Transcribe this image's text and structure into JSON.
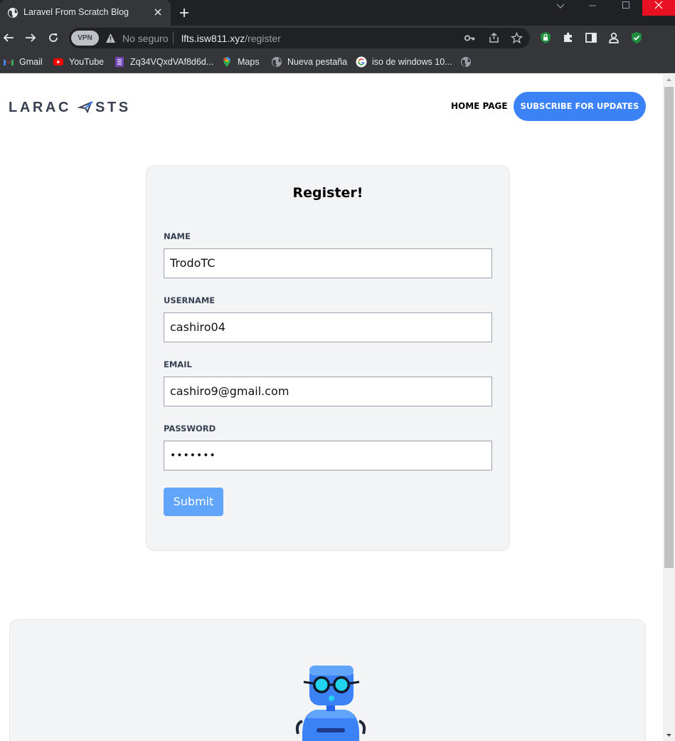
{
  "browser": {
    "tab_title": "Laravel From Scratch Blog",
    "vpn_label": "VPN",
    "security_text": "No seguro",
    "url_host": "lfts.isw811.xyz",
    "url_path": "/register",
    "bookmarks": [
      {
        "label": "Gmail",
        "icon": "gmail-icon"
      },
      {
        "label": "YouTube",
        "icon": "youtube-icon"
      },
      {
        "label": "Zq34VQxdVAf8d6d...",
        "icon": "forms-icon"
      },
      {
        "label": "Maps",
        "icon": "maps-icon"
      },
      {
        "label": "Nueva pestaña",
        "icon": "globe-icon"
      },
      {
        "label": "iso de windows 10...",
        "icon": "google-icon"
      }
    ]
  },
  "site": {
    "logo": "LARACASTS",
    "nav_home": "HOME PAGE",
    "subscribe_label": "SUBSCRIBE FOR UPDATES"
  },
  "form": {
    "title": "Register!",
    "name_label": "NAME",
    "name_value": "TrodoTC",
    "username_label": "USERNAME",
    "username_value": "cashiro04",
    "email_label": "EMAIL",
    "email_value": "cashiro9@gmail.com",
    "password_label": "PASSWORD",
    "password_value": "•••••••",
    "submit_label": "Submit"
  },
  "colors": {
    "accent": "#3b82f6",
    "submit": "#60a5fa",
    "card_bg": "#f3f4f6"
  }
}
